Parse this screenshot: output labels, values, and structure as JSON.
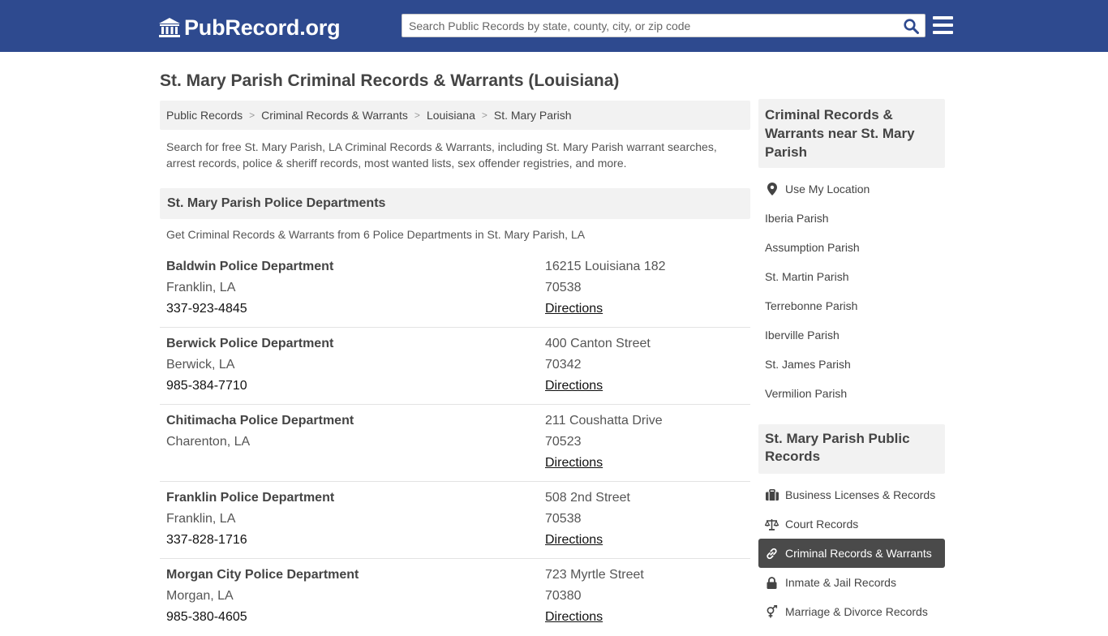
{
  "header": {
    "logo_text": "PubRecord.org",
    "search_placeholder": "Search Public Records by state, county, city, or zip code",
    "search_icon": "search-icon",
    "menu_icon": "hamburger-menu-icon",
    "background_color": "#2e4a8f"
  },
  "page": {
    "title": "St. Mary Parish Criminal Records & Warrants (Louisiana)"
  },
  "breadcrumb": [
    "Public Records",
    "Criminal Records & Warrants",
    "Louisiana",
    "St. Mary Parish"
  ],
  "intro": "Search for free St. Mary Parish, LA Criminal Records & Warrants, including St. Mary Parish warrant searches, arrest records, police & sheriff records, most wanted lists, sex offender registries, and more.",
  "section": {
    "heading": "St. Mary Parish Police Departments",
    "subheading": "Get Criminal Records & Warrants from 6 Police Departments in St. Mary Parish, LA"
  },
  "departments": [
    {
      "name": "Baldwin Police Department",
      "city": "Franklin, LA",
      "phone": "337-923-4845",
      "street": "16215 Louisiana 182",
      "zip": "70538",
      "directions": "Directions"
    },
    {
      "name": "Berwick Police Department",
      "city": "Berwick, LA",
      "phone": "985-384-7710",
      "street": "400 Canton Street",
      "zip": "70342",
      "directions": "Directions"
    },
    {
      "name": "Chitimacha Police Department",
      "city": "Charenton, LA",
      "phone": "",
      "street": "211 Coushatta Drive",
      "zip": "70523",
      "directions": "Directions"
    },
    {
      "name": "Franklin Police Department",
      "city": "Franklin, LA",
      "phone": "337-828-1716",
      "street": "508 2nd Street",
      "zip": "70538",
      "directions": "Directions"
    },
    {
      "name": "Morgan City Police Department",
      "city": "Morgan, LA",
      "phone": "985-380-4605",
      "street": "723 Myrtle Street",
      "zip": "70380",
      "directions": "Directions"
    }
  ],
  "sidebar": {
    "nearby_heading": "Criminal Records & Warrants near St. Mary Parish",
    "use_location": {
      "label": "Use My Location",
      "icon": "location-pin-icon"
    },
    "nearby": [
      "Iberia Parish",
      "Assumption Parish",
      "St. Martin Parish",
      "Terrebonne Parish",
      "Iberville Parish",
      "St. James Parish",
      "Vermilion Parish"
    ],
    "records_heading": "St. Mary Parish Public Records",
    "records": [
      {
        "label": "Business Licenses & Records",
        "icon": "briefcase-icon",
        "active": false
      },
      {
        "label": "Court Records",
        "icon": "scales-icon",
        "active": false
      },
      {
        "label": "Criminal Records & Warrants",
        "icon": "link-icon",
        "active": true
      },
      {
        "label": "Inmate & Jail Records",
        "icon": "lock-icon",
        "active": false
      },
      {
        "label": "Marriage & Divorce Records",
        "icon": "gender-symbol-icon",
        "active": false
      }
    ]
  }
}
